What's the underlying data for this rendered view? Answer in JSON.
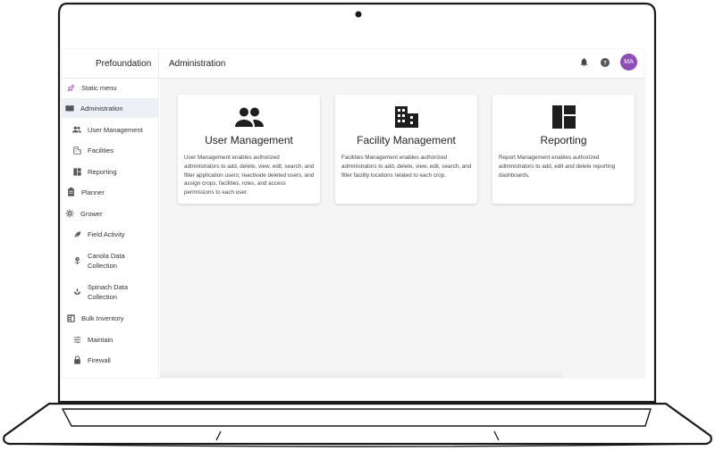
{
  "app": {
    "brand": "Prefoundation",
    "page_title": "Administration",
    "avatar_initials": "MA",
    "avatar_color": "#8d4fb6"
  },
  "sidebar": {
    "items": [
      {
        "label": "Static menu",
        "icon": "pin-icon"
      },
      {
        "label": "Administration",
        "icon": "book-icon",
        "active": true
      },
      {
        "label": "User Management",
        "icon": "people-icon"
      },
      {
        "label": "Facilities",
        "icon": "building-icon"
      },
      {
        "label": "Reporting",
        "icon": "dashboard-icon"
      },
      {
        "label": "Planner",
        "icon": "clipboard-icon"
      },
      {
        "label": "Grower",
        "icon": "flower-icon"
      },
      {
        "label": "Field Activity",
        "icon": "leaf-icon"
      },
      {
        "label": "Canola Data Collection",
        "icon": "canola-icon"
      },
      {
        "label": "Spinach Data Collection",
        "icon": "spinach-icon"
      },
      {
        "label": "Bulk Inventory",
        "icon": "inventory-icon"
      },
      {
        "label": "Maintain",
        "icon": "sliders-icon"
      },
      {
        "label": "Firewall",
        "icon": "lock-icon"
      }
    ]
  },
  "cards": [
    {
      "title": "User Management",
      "icon": "people-icon",
      "description": "User Management enables authorized administrators to add, delete, view, edit, search, and filter application users; reactivate deleted users, and assign crops, facilities, roles, and access permissions to each user."
    },
    {
      "title": "Facility Management",
      "icon": "building-icon",
      "description": "Facilities Management enables authorized administrators to add, delete, view, edit, search, and filter facility locations related to each crop."
    },
    {
      "title": "Reporting",
      "icon": "dashboard-icon",
      "description": "Report Management enables authorized administrators to add, edit and delete reporting dashboards."
    }
  ]
}
